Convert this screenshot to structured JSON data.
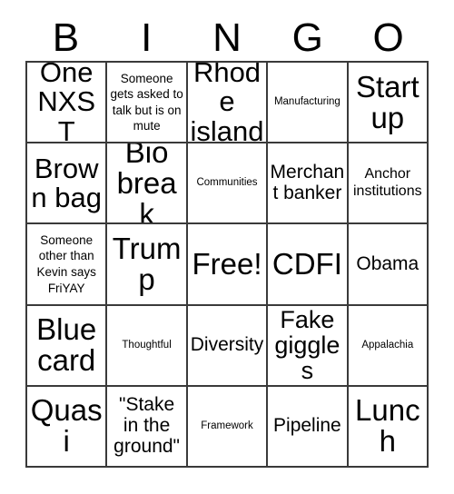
{
  "card": {
    "title": "BINGO",
    "header_letters": [
      "B",
      "I",
      "N",
      "G",
      "O"
    ],
    "colors": {
      "background": "#ffffff",
      "cell_background": "#ffffff",
      "border": "#3a3a3a",
      "text": "#000000"
    },
    "grid_size": "5x5",
    "free_space_label": "Free!",
    "rows": [
      [
        {
          "text": "One NXST",
          "size": "xl"
        },
        {
          "text": "Someone gets asked to talk but is on mute",
          "size": "xs"
        },
        {
          "text": "Rhode island",
          "size": "xl"
        },
        {
          "text": "Manufacturing",
          "size": "xxs"
        },
        {
          "text": "Start up",
          "size": "xxl"
        }
      ],
      [
        {
          "text": "Brown bag",
          "size": "xl"
        },
        {
          "text": "Bio break",
          "size": "xxl"
        },
        {
          "text": "Communities",
          "size": "xxs"
        },
        {
          "text": "Merchant banker",
          "size": "md"
        },
        {
          "text": "Anchor institutions",
          "size": "sm"
        }
      ],
      [
        {
          "text": "Someone other than Kevin says FriYAY",
          "size": "xs"
        },
        {
          "text": "Trump",
          "size": "xxl"
        },
        {
          "text": "Free!",
          "size": "xxl"
        },
        {
          "text": "CDFI",
          "size": "xxl"
        },
        {
          "text": "Obama",
          "size": "md"
        }
      ],
      [
        {
          "text": "Blue card",
          "size": "xxl"
        },
        {
          "text": "Thoughtful",
          "size": "xxs"
        },
        {
          "text": "Diversity",
          "size": "md"
        },
        {
          "text": "Fake giggles",
          "size": "lg"
        },
        {
          "text": "Appalachia",
          "size": "xxs"
        }
      ],
      [
        {
          "text": "Quasi",
          "size": "xxl"
        },
        {
          "text": "\"Stake in the ground\"",
          "size": "md"
        },
        {
          "text": "Framework",
          "size": "xxs"
        },
        {
          "text": "Pipeline",
          "size": "md"
        },
        {
          "text": "Lunch",
          "size": "xxl"
        }
      ]
    ]
  }
}
